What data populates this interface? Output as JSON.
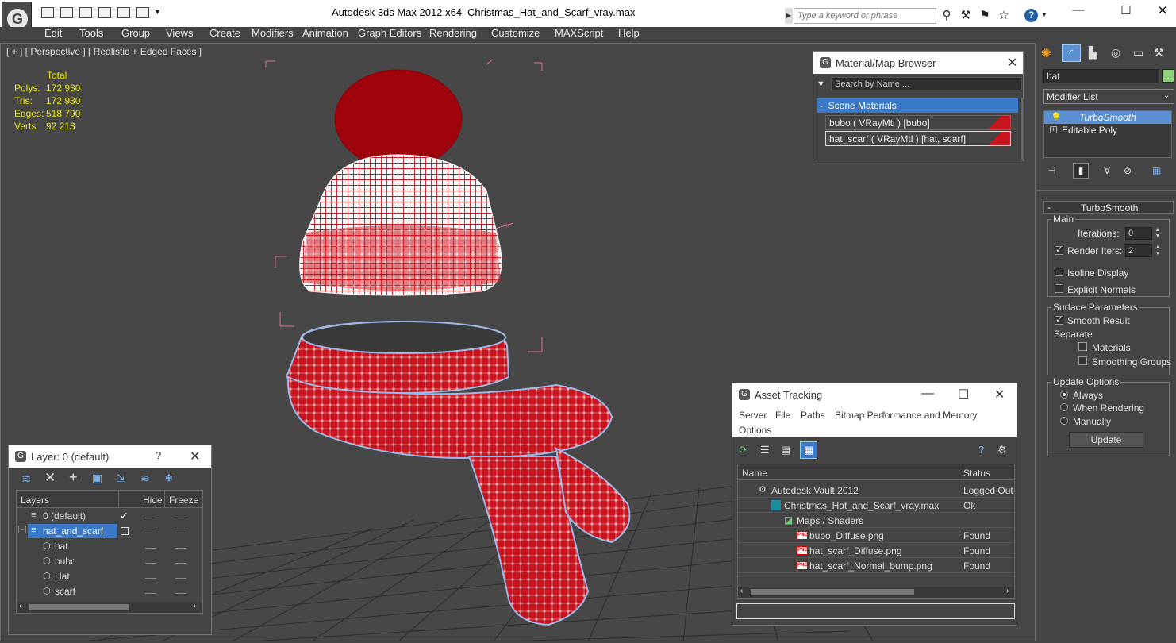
{
  "titlebar": {
    "app_title": "Autodesk 3ds Max  2012 x64",
    "file_name": "Christmas_Hat_and_Scarf_vray.max",
    "search_placeholder": "Type a keyword or phrase",
    "minimize": "—",
    "maximize": "☐",
    "close": "✕"
  },
  "menu": [
    "Edit",
    "Tools",
    "Group",
    "Views",
    "Create",
    "Modifiers",
    "Animation",
    "Graph Editors",
    "Rendering",
    "Customize",
    "MAXScript",
    "Help"
  ],
  "viewport": {
    "label": "[ + ] [ Perspective ] [ Realistic + Edged Faces ]",
    "stats_header": "Total",
    "stats": [
      {
        "label": "Polys:",
        "value": "172 930"
      },
      {
        "label": "Tris:",
        "value": "172 930"
      },
      {
        "label": "Edges:",
        "value": "518 790"
      },
      {
        "label": "Verts:",
        "value": "92 213"
      }
    ]
  },
  "material_browser": {
    "title": "Material/Map Browser",
    "search_placeholder": "Search by Name ...",
    "group": "Scene Materials",
    "items": [
      "bubo  ( VRayMtl ) [bubo]",
      "hat_scarf  ( VRayMtl ) [hat, scarf]"
    ]
  },
  "layer_dialog": {
    "title": "Layer: 0 (default)",
    "help": "?",
    "close": "✕",
    "columns": {
      "layers": "Layers",
      "hide": "Hide",
      "freeze": "Freeze"
    },
    "rows": [
      {
        "name": "0 (default)",
        "level": 0
      },
      {
        "name": "hat_and_scarf",
        "level": 0
      },
      {
        "name": "hat",
        "level": 1
      },
      {
        "name": "bubo",
        "level": 1
      },
      {
        "name": "Hat",
        "level": 1
      },
      {
        "name": "scarf",
        "level": 1
      }
    ]
  },
  "asset_tracking": {
    "title": "Asset Tracking",
    "menu": [
      "Server",
      "File",
      "Paths",
      "Bitmap Performance and Memory",
      "Options"
    ],
    "columns": {
      "name": "Name",
      "status": "Status"
    },
    "rows": [
      {
        "name": "Autodesk Vault 2012",
        "status": "Logged Out"
      },
      {
        "name": "Christmas_Hat_and_Scarf_vray.max",
        "status": "Ok"
      },
      {
        "name": "Maps / Shaders",
        "status": ""
      },
      {
        "name": "bubo_Diffuse.png",
        "status": "Found"
      },
      {
        "name": "hat_scarf_Diffuse.png",
        "status": "Found"
      },
      {
        "name": "hat_scarf_Normal_bump.png",
        "status": "Found"
      }
    ],
    "png_badge": "PNG"
  },
  "command_panel": {
    "object_name": "hat",
    "object_color": "#8fd17a",
    "modifier_list": "Modifier List",
    "stack": [
      "TurboSmooth",
      "Editable Poly"
    ],
    "rollout_title": "TurboSmooth",
    "main_group": "Main",
    "iterations_label": "Iterations:",
    "iterations_value": "0",
    "render_iters_label": "Render Iters:",
    "render_iters_value": "2",
    "isoline_label": "Isoline Display",
    "explicit_normals_label": "Explicit Normals",
    "surface_group": "Surface Parameters",
    "smooth_result_label": "Smooth Result",
    "separate_label": "Separate",
    "materials_label": "Materials",
    "smoothing_groups_label": "Smoothing Groups",
    "update_group": "Update Options",
    "always_label": "Always",
    "when_rendering_label": "When Rendering",
    "manually_label": "Manually",
    "update_button": "Update",
    "collapse": "-"
  },
  "colors": {
    "selection": "#3a78c8",
    "knit_red": "#c8141e",
    "wire_pink": "#e0708a"
  }
}
